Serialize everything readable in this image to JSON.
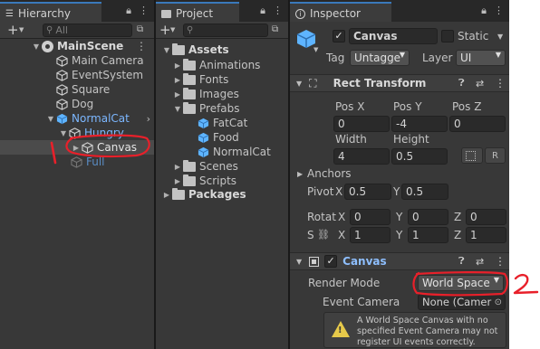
{
  "hierarchy": {
    "tab_label": "Hierarchy",
    "search_placeholder": "All",
    "scene": "MainScene",
    "items": [
      {
        "label": "Main Camera"
      },
      {
        "label": "EventSystem"
      },
      {
        "label": "Square"
      },
      {
        "label": "Dog"
      },
      {
        "label": "NormalCat"
      },
      {
        "label": "Hungry"
      },
      {
        "label": "Canvas"
      },
      {
        "label": "Full"
      }
    ]
  },
  "project": {
    "tab_label": "Project",
    "items": [
      {
        "label": "Assets"
      },
      {
        "label": "Animations"
      },
      {
        "label": "Fonts"
      },
      {
        "label": "Images"
      },
      {
        "label": "Prefabs"
      },
      {
        "label": "FatCat"
      },
      {
        "label": "Food"
      },
      {
        "label": "NormalCat"
      },
      {
        "label": "Scenes"
      },
      {
        "label": "Scripts"
      },
      {
        "label": "Packages"
      }
    ]
  },
  "inspector": {
    "tab_label": "Inspector",
    "object_name": "Canvas",
    "static_label": "Static",
    "tag_label": "Tag",
    "tag_value": "Untagge",
    "layer_label": "Layer",
    "layer_value": "UI",
    "rect_transform": {
      "title": "Rect Transform",
      "pos_x_label": "Pos X",
      "pos_x": "0",
      "pos_y_label": "Pos Y",
      "pos_y": "-4",
      "pos_z_label": "Pos Z",
      "pos_z": "0",
      "width_label": "Width",
      "width": "4",
      "height_label": "Height",
      "height": "0.5",
      "r_label": "R",
      "anchors_label": "Anchors",
      "pivot_label": "Pivot",
      "pivot_x_label": "X",
      "pivot_x": "0.5",
      "pivot_y_label": "Y",
      "pivot_y": "0.5",
      "rotation_label": "Rotat",
      "rot_x_label": "X",
      "rot_x": "0",
      "rot_y_label": "Y",
      "rot_y": "0",
      "rot_z_label": "Z",
      "rot_z": "0",
      "scale_label": "S",
      "scale_x_label": "X",
      "scale_x": "1",
      "scale_y_label": "Y",
      "scale_y": "1",
      "scale_z_label": "Z",
      "scale_z": "1"
    },
    "canvas": {
      "title": "Canvas",
      "render_mode_label": "Render Mode",
      "render_mode_value": "World Space",
      "event_camera_label": "Event Camera",
      "event_camera_value": "None (Camer",
      "help_line1": "A World Space Canvas with no",
      "help_line2": "specified Event Camera may not",
      "help_line3": "register UI events correctly."
    }
  },
  "annotations": {
    "mark_1": "1",
    "mark_2": "2",
    "color": "#e8202a"
  },
  "colors": {
    "accent_blue": "#3a79bb",
    "prefab_blue": "#7cb7ff",
    "panel_bg": "#383838"
  }
}
